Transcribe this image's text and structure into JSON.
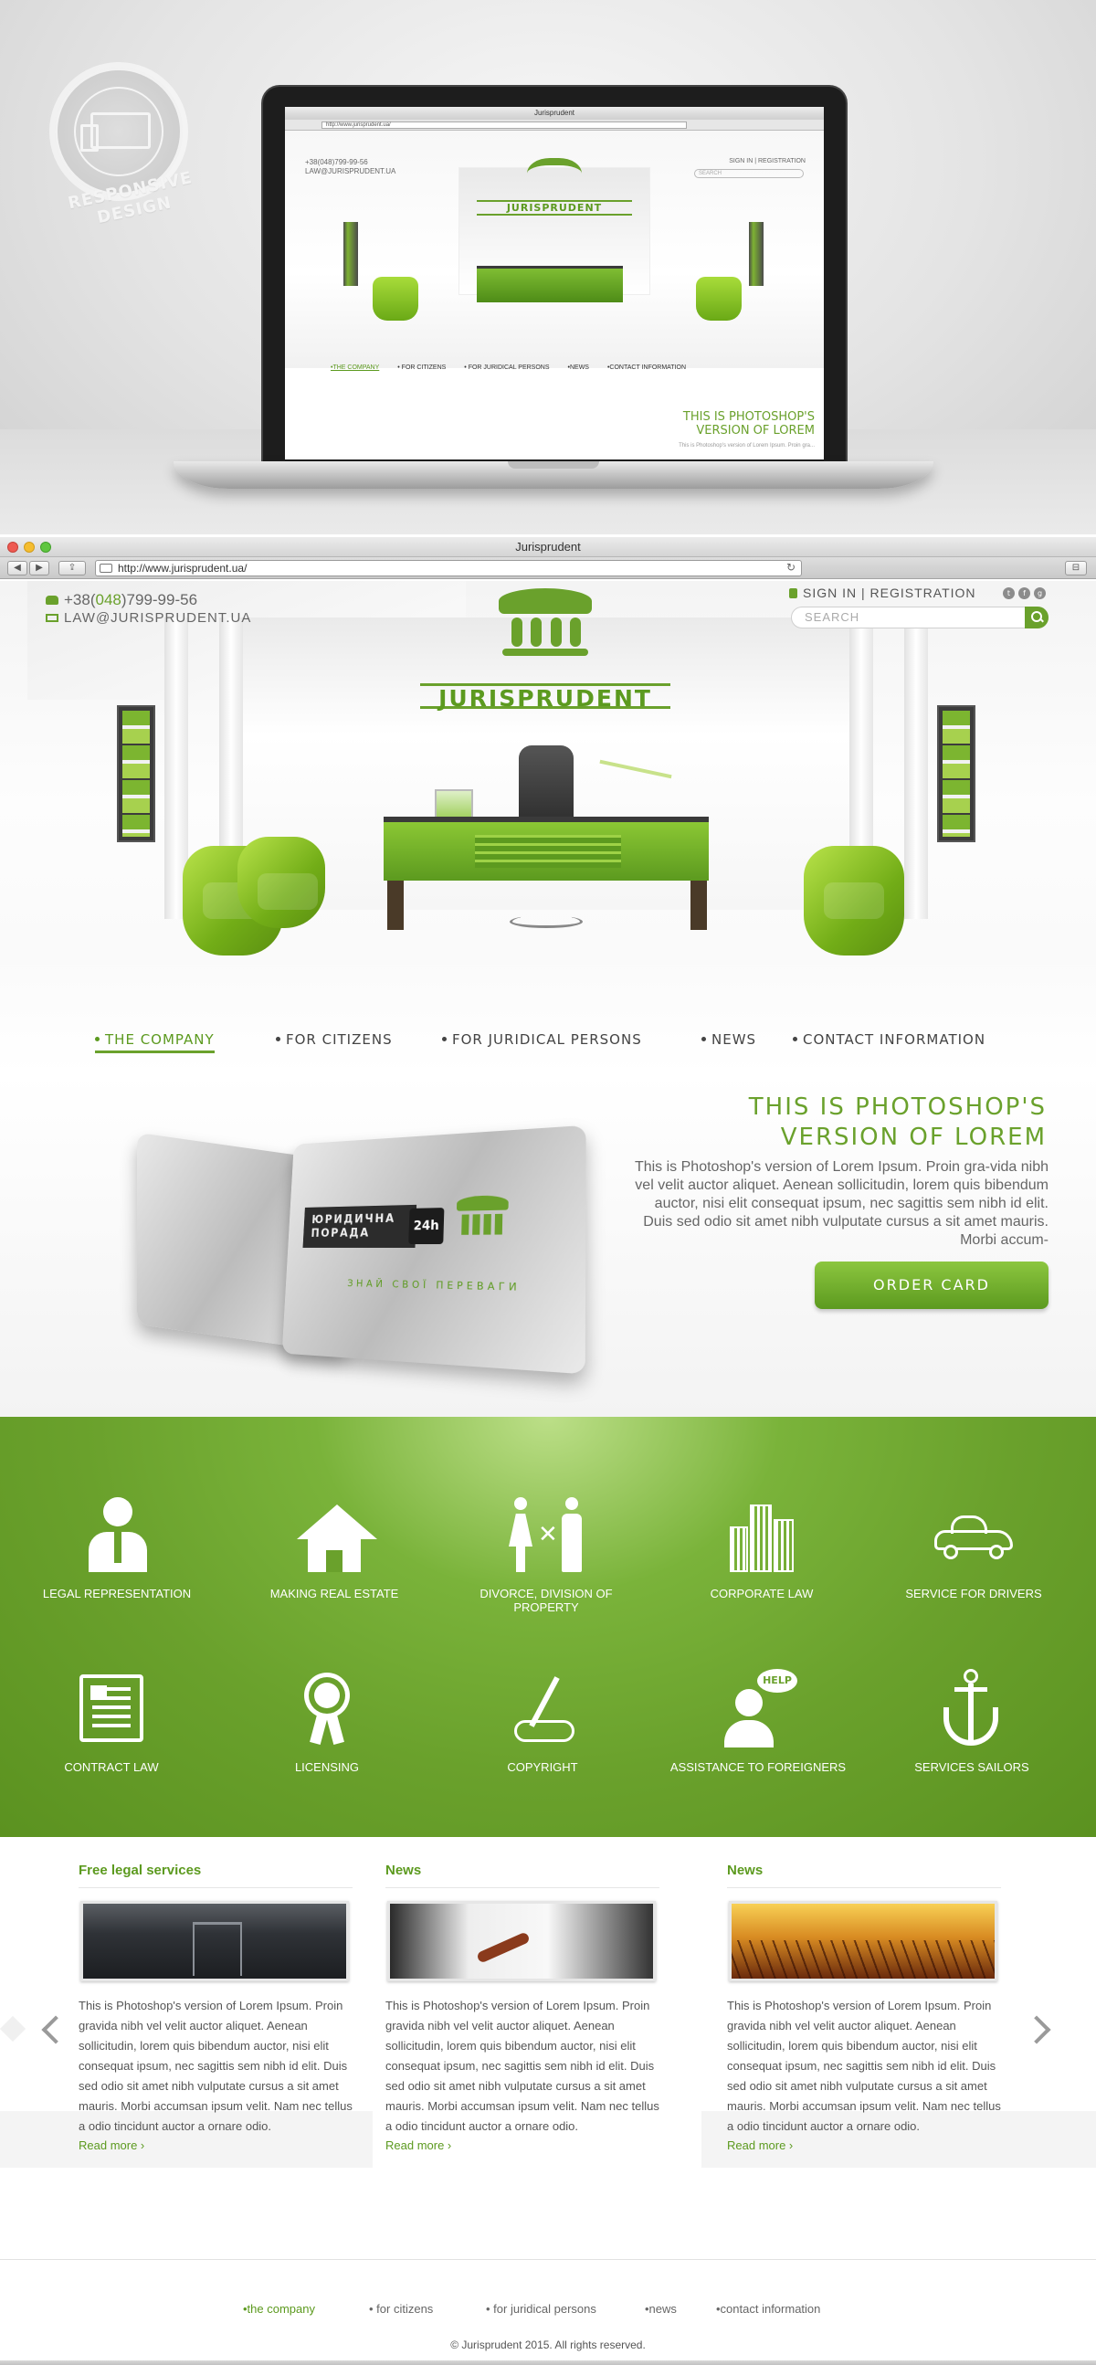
{
  "showcase": {
    "badge_line1": "RESPONSIVE",
    "badge_line2": "DESIGN",
    "mini_window_title": "Jurisprudent",
    "mini_url": "http://www.jurisprudent.ua/",
    "mini_phone": "+38(048)799-99-56",
    "mini_email": "LAW@JURISPRUDENT.UA",
    "mini_sign": "SIGN IN | REGISTRATION",
    "mini_search": "SEARCH",
    "mini_name": "JURISPRUDENT",
    "mini_nav": [
      "•THE COMPANY",
      "• FOR CITIZENS",
      "• FOR JURIDICAL PERSONS",
      "•NEWS",
      "•CONTACT INFORMATION"
    ],
    "mini_title": "THIS IS PHOTOSHOP'S VERSION  OF LOREM",
    "mini_text": "This is Photoshop's version  of Lorem Ipsum. Proin gra..."
  },
  "browser": {
    "title": "Jurisprudent",
    "url": "http://www.jurisprudent.ua/",
    "back": "◀",
    "forward": "▶",
    "share": "⇪",
    "reload": "↻",
    "menu": "⊟"
  },
  "header": {
    "phone_prefix": "+38(",
    "phone_code": "048",
    "phone_rest": ")799-99-56",
    "email": "LAW@JURISPRUDENT.UA",
    "sign_in": "SIGN IN",
    "separator": " | ",
    "registration": "REGISTRATION",
    "social": [
      "t",
      "f",
      "g"
    ],
    "search_placeholder": "SEARCH",
    "site_name": "JURISPRUDENT"
  },
  "nav": {
    "items": [
      "THE COMPANY",
      "FOR CITIZENS",
      "FOR JURIDICAL PERSONS",
      "NEWS",
      "CONTACT INFORMATION"
    ]
  },
  "promo": {
    "title_line1": "THIS IS PHOTOSHOP'S",
    "title_line2": "VERSION  OF LOREM",
    "text": "This is Photoshop's version  of Lorem Ipsum. Proin gra-vida nibh vel velit auctor aliquet. Aenean sollicitudin, lorem quis bibendum auctor, nisi elit consequat ipsum, nec sagittis sem nibh id elit. Duis sed odio sit amet nibh vulputate cursus a sit amet mauris. Morbi accum-",
    "button": "ORDER CARD",
    "card_label": "ЮРИДИЧНА ПОРАДА",
    "card_hours": "24h",
    "card_slogan": "ЗНАЙ СВОЇ ПЕРЕВАГИ"
  },
  "services": [
    {
      "label": "LEGAL REPRESENTATION",
      "icon": "person-tie-icon"
    },
    {
      "label": "MAKING REAL ESTATE",
      "icon": "house-icon"
    },
    {
      "label": "DIVORCE, DIVISION OF PROPERTY",
      "icon": "couple-icon"
    },
    {
      "label": "CORPORATE LAW",
      "icon": "buildings-icon"
    },
    {
      "label": "SERVICE FOR DRIVERS",
      "icon": "car-icon"
    },
    {
      "label": "CONTRACT LAW",
      "icon": "document-icon"
    },
    {
      "label": "LICENSING",
      "icon": "seal-icon"
    },
    {
      "label": "COPYRIGHT",
      "icon": "pen-hand-icon"
    },
    {
      "label": "ASSISTANCE TO FOREIGNERS",
      "icon": "help-person-icon",
      "bubble": "help"
    },
    {
      "label": "SERVICES SAILORS",
      "icon": "anchor-icon"
    }
  ],
  "news": [
    {
      "heading": "Free legal services",
      "text": "This is Photoshop's version  of Lorem Ipsum. Proin gravida nibh vel velit auctor aliquet. Aenean sollicitudin, lorem quis bibendum auctor, nisi elit consequat ipsum, nec sagittis sem nibh id elit. Duis sed odio sit amet nibh vulputate cursus a sit amet mauris. Morbi accumsan ipsum velit. Nam nec tellus a odio tincidunt auctor a ornare odio.",
      "more": "Read more ›"
    },
    {
      "heading": "News",
      "text": "This is Photoshop's version  of Lorem Ipsum. Proin gravida nibh vel velit auctor aliquet. Aenean sollicitudin, lorem quis bibendum auctor, nisi elit consequat ipsum, nec sagittis sem nibh id elit. Duis sed odio sit amet nibh vulputate cursus a sit amet mauris. Morbi accumsan ipsum velit. Nam nec tellus a odio tincidunt auctor a ornare odio.",
      "more": "Read more ›"
    },
    {
      "heading": "News",
      "text": "This is Photoshop's version  of Lorem Ipsum. Proin gravida nibh vel velit auctor aliquet. Aenean sollicitudin, lorem quis bibendum auctor, nisi elit consequat ipsum, nec sagittis sem nibh id elit. Duis sed odio sit amet nibh vulputate cursus a sit amet mauris. Morbi accumsan ipsum velit. Nam nec tellus a odio tincidunt auctor a ornare odio.",
      "more": "Read more ›"
    }
  ],
  "footer": {
    "nav": [
      "•the company",
      "• for citizens",
      "• for juridical persons",
      "•news",
      "•contact information"
    ],
    "copyright": "© Jurisprudent 2015. All rights reserved."
  },
  "colors": {
    "accent": "#6aa12c",
    "accent_dark": "#5c9a1f",
    "text": "#555555"
  }
}
